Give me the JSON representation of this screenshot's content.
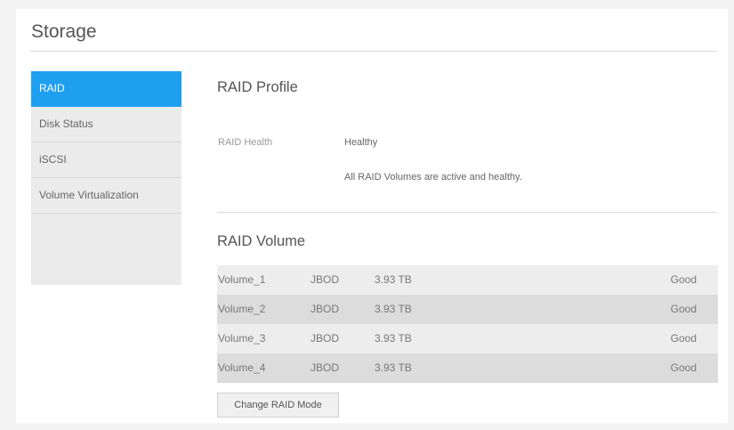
{
  "page": {
    "title": "Storage"
  },
  "sidebar": {
    "items": [
      {
        "label": "RAID",
        "active": true
      },
      {
        "label": "Disk Status",
        "active": false
      },
      {
        "label": "iSCSI",
        "active": false
      },
      {
        "label": "Volume Virtualization",
        "active": false
      }
    ]
  },
  "raid_profile": {
    "title": "RAID Profile",
    "health_label": "RAID Health",
    "health_value": "Healthy",
    "health_message": "All RAID Volumes are active and healthy."
  },
  "raid_volume": {
    "title": "RAID Volume",
    "rows": [
      {
        "name": "Volume_1",
        "type": "JBOD",
        "size": "3.93 TB",
        "status": "Good"
      },
      {
        "name": "Volume_2",
        "type": "JBOD",
        "size": "3.93 TB",
        "status": "Good"
      },
      {
        "name": "Volume_3",
        "type": "JBOD",
        "size": "3.93 TB",
        "status": "Good"
      },
      {
        "name": "Volume_4",
        "type": "JBOD",
        "size": "3.93 TB",
        "status": "Good"
      }
    ]
  },
  "actions": {
    "change_raid_mode_label": "Change RAID Mode"
  },
  "colors": {
    "accent": "#1f9ff0"
  }
}
